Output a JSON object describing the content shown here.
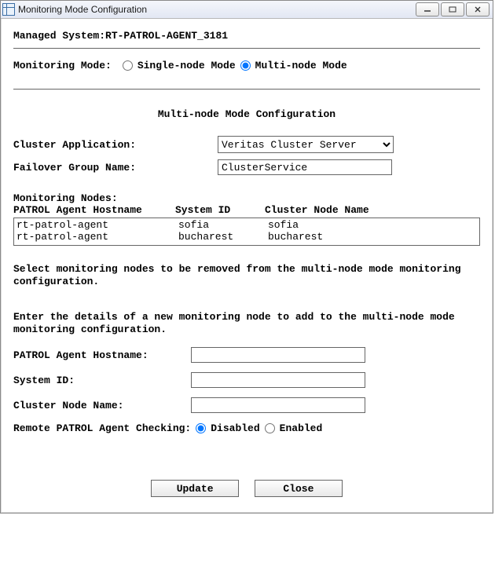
{
  "window": {
    "title": "Monitoring Mode Configuration"
  },
  "managed_system": {
    "label": "Managed System:",
    "value": "RT-PATROL-AGENT_3181"
  },
  "monitoring_mode": {
    "label": "Monitoring Mode:",
    "options": {
      "single": "Single-node Mode",
      "multi": "Multi-node Mode"
    },
    "selected": "multi"
  },
  "multi_config": {
    "title": "Multi-node Mode Configuration",
    "cluster_app": {
      "label": "Cluster Application:",
      "value": "Veritas Cluster Server"
    },
    "failover_group": {
      "label": "Failover Group Name:",
      "value": "ClusterService"
    }
  },
  "nodes": {
    "label": "Monitoring Nodes:",
    "headers": {
      "host": "PATROL Agent Hostname",
      "sysid": "System ID",
      "cluster": "Cluster Node Name"
    },
    "rows": [
      {
        "host": "rt-patrol-agent",
        "sysid": "sofia",
        "cluster": "sofia"
      },
      {
        "host": "rt-patrol-agent",
        "sysid": "bucharest",
        "cluster": "bucharest"
      }
    ]
  },
  "help": {
    "remove": "Select monitoring nodes to be removed from the multi-node mode monitoring configuration.",
    "add": "Enter the details of a new monitoring node to add to the multi-node mode monitoring configuration."
  },
  "new_node": {
    "host_label": "PATROL Agent Hostname:",
    "host_value": "",
    "sysid_label": "System ID:",
    "sysid_value": "",
    "cluster_label": "Cluster Node Name:",
    "cluster_value": ""
  },
  "remote_check": {
    "label": "Remote PATROL Agent Checking:",
    "options": {
      "disabled": "Disabled",
      "enabled": "Enabled"
    },
    "selected": "disabled"
  },
  "buttons": {
    "update": "Update",
    "close": "Close"
  }
}
